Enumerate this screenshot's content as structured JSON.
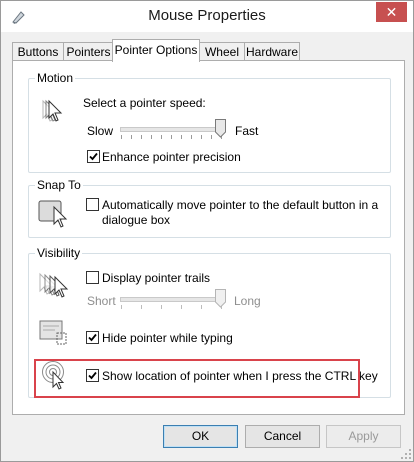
{
  "window": {
    "title": "Mouse Properties",
    "close_glyph": "✕"
  },
  "tabs": [
    {
      "label": "Buttons",
      "active": false
    },
    {
      "label": "Pointers",
      "active": false
    },
    {
      "label": "Pointer Options",
      "active": true
    },
    {
      "label": "Wheel",
      "active": false
    },
    {
      "label": "Hardware",
      "active": false
    }
  ],
  "motion": {
    "group_label": "Motion",
    "speed_label": "Select a pointer speed:",
    "slow_label": "Slow",
    "fast_label": "Fast",
    "speed_level": 0.98,
    "enhance_label": "Enhance pointer precision",
    "enhance_checked": true
  },
  "snap_to": {
    "group_label": "Snap To",
    "option_label_line1": "Automatically move pointer to the default button in a",
    "option_label_line2": "dialogue box",
    "checked": false
  },
  "visibility": {
    "group_label": "Visibility",
    "trails_label": "Display pointer trails",
    "trails_checked": false,
    "short_label": "Short",
    "long_label": "Long",
    "trails_level": 0.98,
    "hide_label": "Hide pointer while typing",
    "hide_checked": true,
    "ctrl_label": "Show location of pointer when I press the CTRL key",
    "ctrl_checked": true,
    "highlight_color": "#d9434b"
  },
  "buttons": {
    "ok": "OK",
    "cancel": "Cancel",
    "apply": "Apply"
  }
}
